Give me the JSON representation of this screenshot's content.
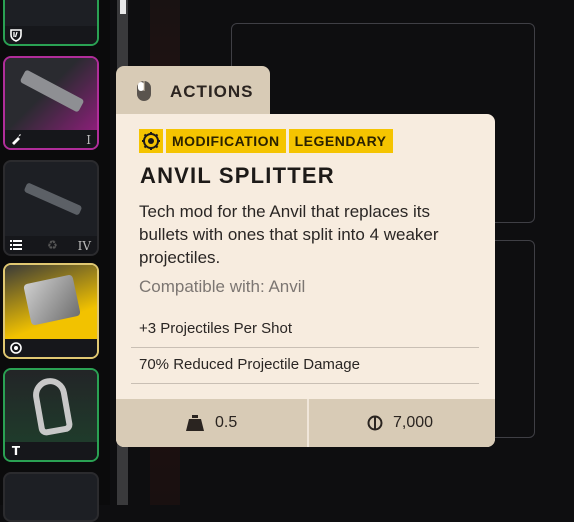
{
  "inventory": {
    "slots": [
      {
        "rarity": "uncommon",
        "rarity_color": "#2aa153",
        "footer_icon": "shield-icon",
        "tier": ""
      },
      {
        "rarity": "epic",
        "rarity_color": "#b02d9a",
        "footer_icon": "bullet-icon",
        "tier": "I"
      },
      {
        "rarity": "common",
        "rarity_color": "#2b2b2e",
        "footer_icon": "list-icon",
        "tier": "IV"
      },
      {
        "rarity": "legendary",
        "rarity_color": "#f5c400",
        "footer_icon": "gear-icon",
        "tier": ""
      },
      {
        "rarity": "uncommon",
        "rarity_color": "#2aa153",
        "footer_icon": "t-icon",
        "tier": ""
      },
      {
        "rarity": "common",
        "rarity_color": "#2b2b2e",
        "footer_icon": "",
        "tier": ""
      }
    ]
  },
  "actions_tab": {
    "label": "ACTIONS",
    "icon": "mouse-icon"
  },
  "tooltip": {
    "tags": [
      "MODIFICATION",
      "LEGENDARY"
    ],
    "tag_icon": "gear-icon",
    "title": "ANVIL SPLITTER",
    "description": "Tech mod for the Anvil that replaces its bullets with ones that split into 4 weaker projectiles.",
    "compatible": "Compatible with: Anvil",
    "stats": [
      "+3 Projectiles Per Shot",
      "70% Reduced Projectile Damage"
    ],
    "weight": "0.5",
    "price": "7,000",
    "accent_color": "#f5c400"
  }
}
